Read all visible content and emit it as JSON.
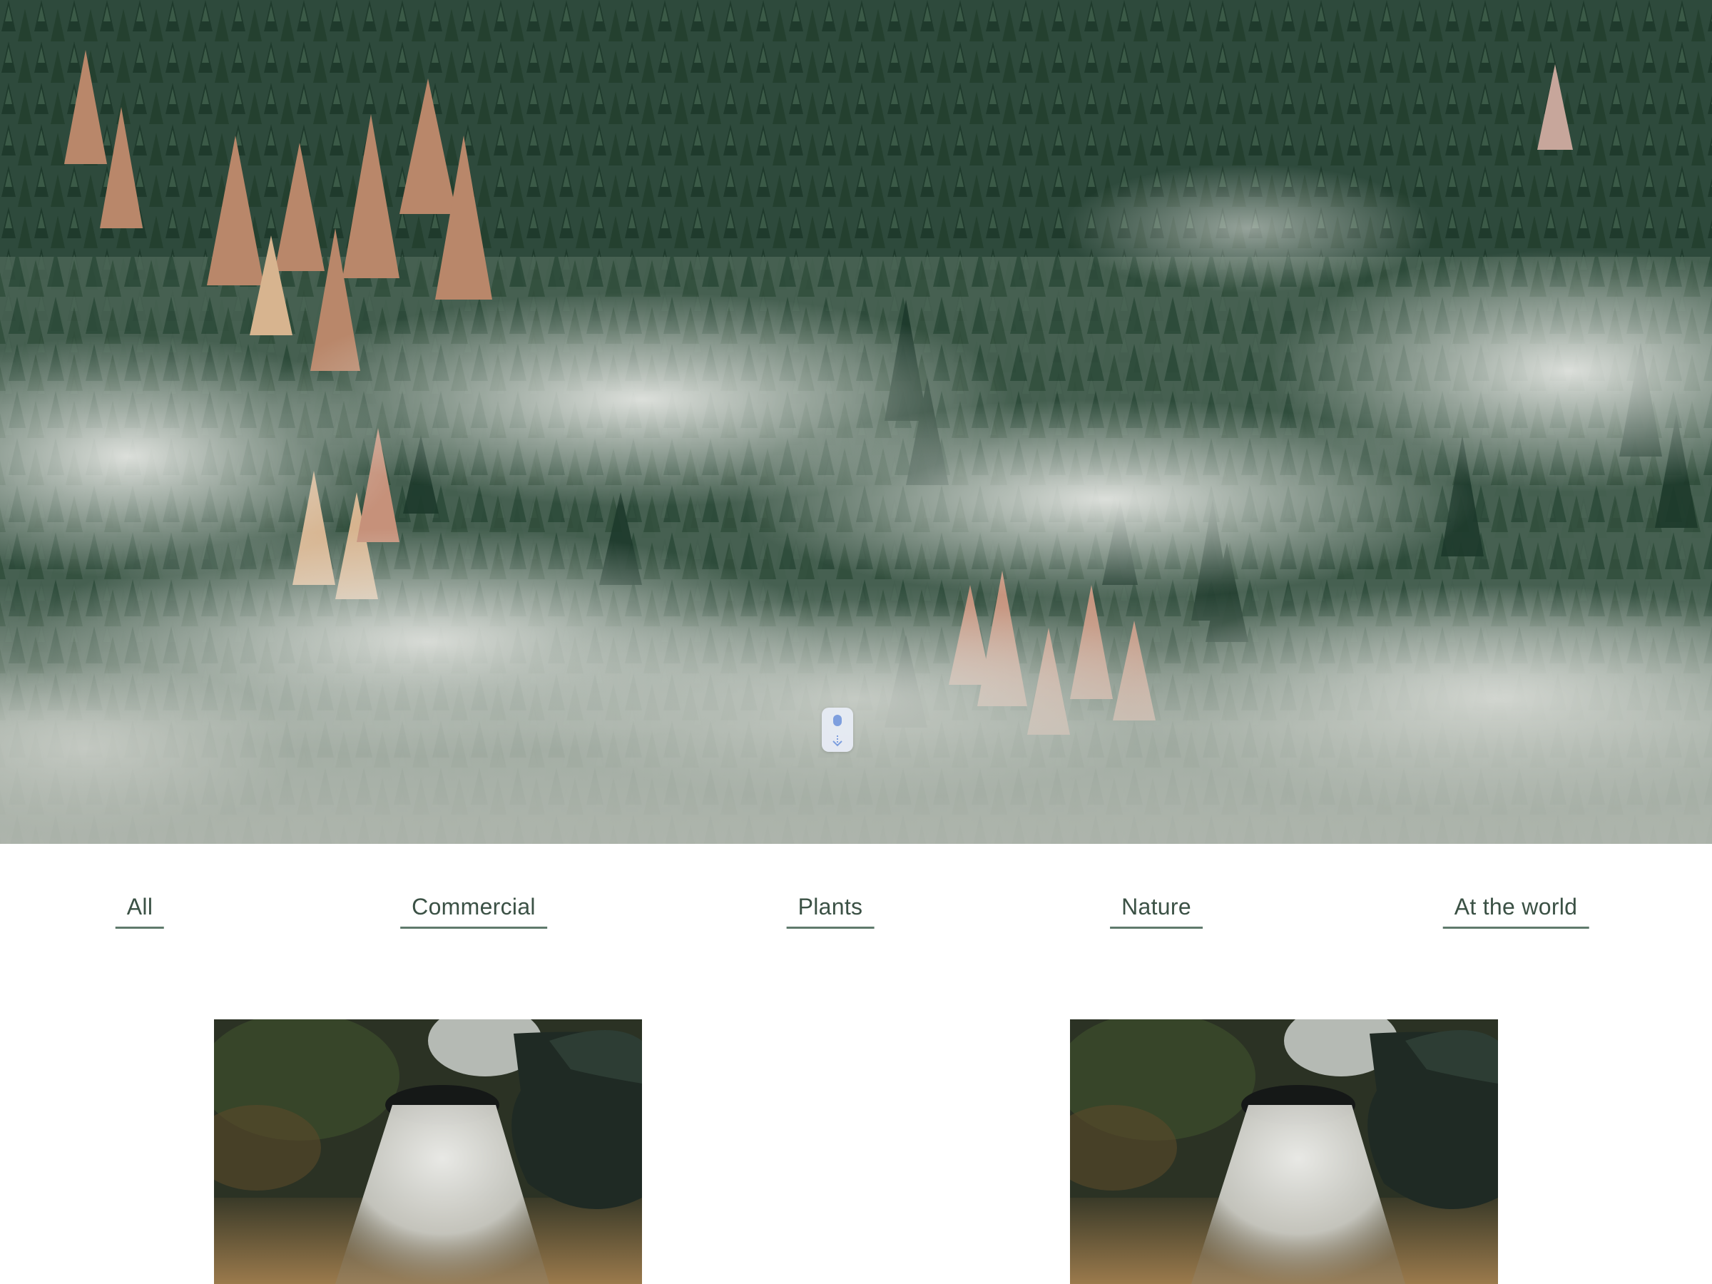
{
  "hero": {
    "image": "misty-forest-aerial-photo",
    "scroll_indicator_icon": "mouse-scroll-down-icon"
  },
  "filters": {
    "items": [
      {
        "label": "All"
      },
      {
        "label": "Commercial"
      },
      {
        "label": "Plants"
      },
      {
        "label": "Nature"
      },
      {
        "label": "At the world"
      }
    ],
    "text_color": "#3b5145",
    "underline_color": "#5f7a6c"
  },
  "gallery": {
    "items": [
      {
        "image": "watering-can-photo"
      },
      {
        "image": "watering-can-photo"
      }
    ]
  },
  "colors": {
    "accent": "#7e9fde",
    "background": "#ffffff"
  }
}
